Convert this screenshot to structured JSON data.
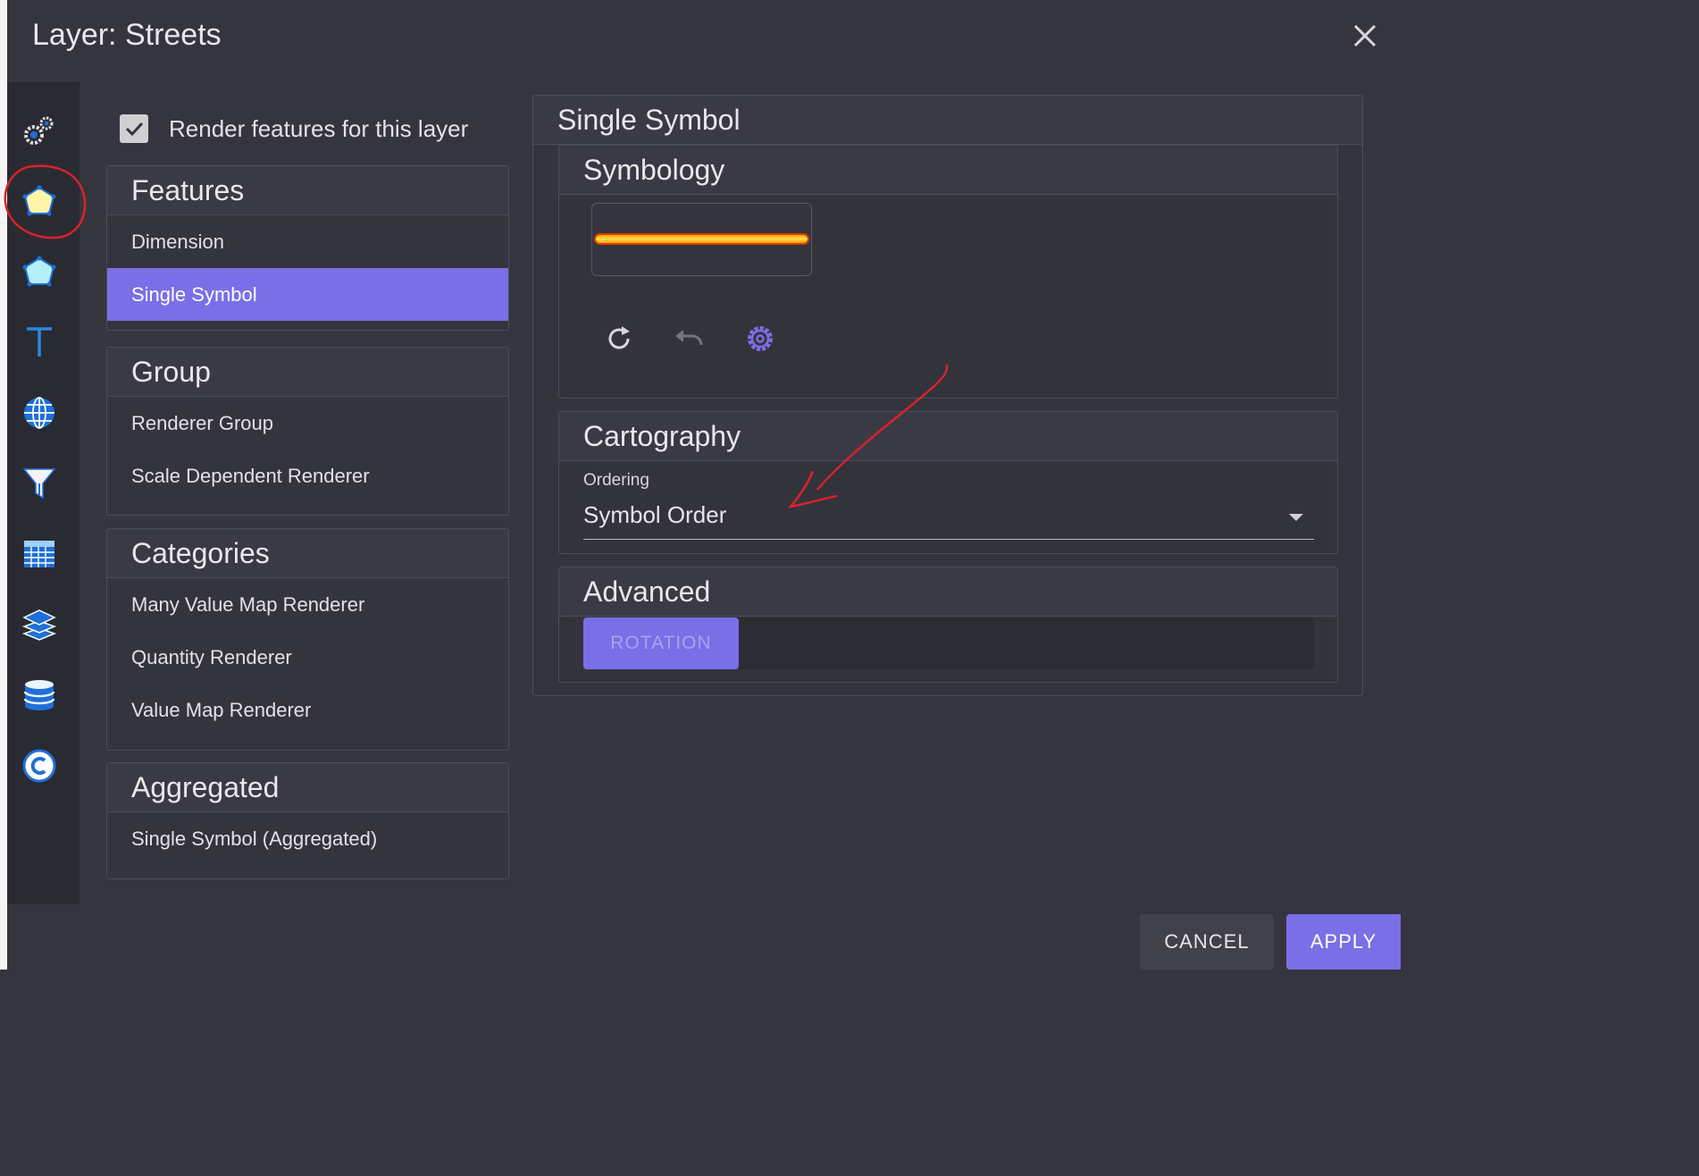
{
  "dialog": {
    "title": "Layer: Streets"
  },
  "sidebar_icons": [
    "gears-icon",
    "polygon-yellow-icon",
    "polygon-cyan-icon",
    "text-t-icon",
    "globe-icon",
    "funnel-icon",
    "table-icon",
    "layers-icon",
    "database-icon",
    "copyright-icon"
  ],
  "render": {
    "label": "Render features for this layer",
    "checked": true
  },
  "renderer_groups": [
    {
      "header": "Features",
      "items": [
        "Dimension",
        "Single Symbol"
      ]
    },
    {
      "header": "Group",
      "items": [
        "Renderer Group",
        "Scale Dependent Renderer"
      ]
    },
    {
      "header": "Categories",
      "items": [
        "Many Value Map Renderer",
        "Quantity Renderer",
        "Value Map Renderer"
      ]
    },
    {
      "header": "Aggregated",
      "items": [
        "Single Symbol (Aggregated)"
      ]
    }
  ],
  "selected_renderer": "Single Symbol",
  "panel": {
    "title": "Single Symbol",
    "symbology": {
      "header": "Symbology",
      "toolbar_icons": [
        "refresh-icon",
        "undo-icon",
        "settings-gear-icon"
      ]
    },
    "cartography": {
      "header": "Cartography",
      "ordering_label": "Ordering",
      "ordering_value": "Symbol Order"
    },
    "advanced": {
      "header": "Advanced",
      "rotation_button": "ROTATION"
    }
  },
  "footer": {
    "cancel": "CANCEL",
    "apply": "APPLY"
  },
  "colors": {
    "accent": "#7a6fe6",
    "background": "#35353f",
    "annotation": "#d9222a",
    "symbol_line": "#ffd400"
  }
}
